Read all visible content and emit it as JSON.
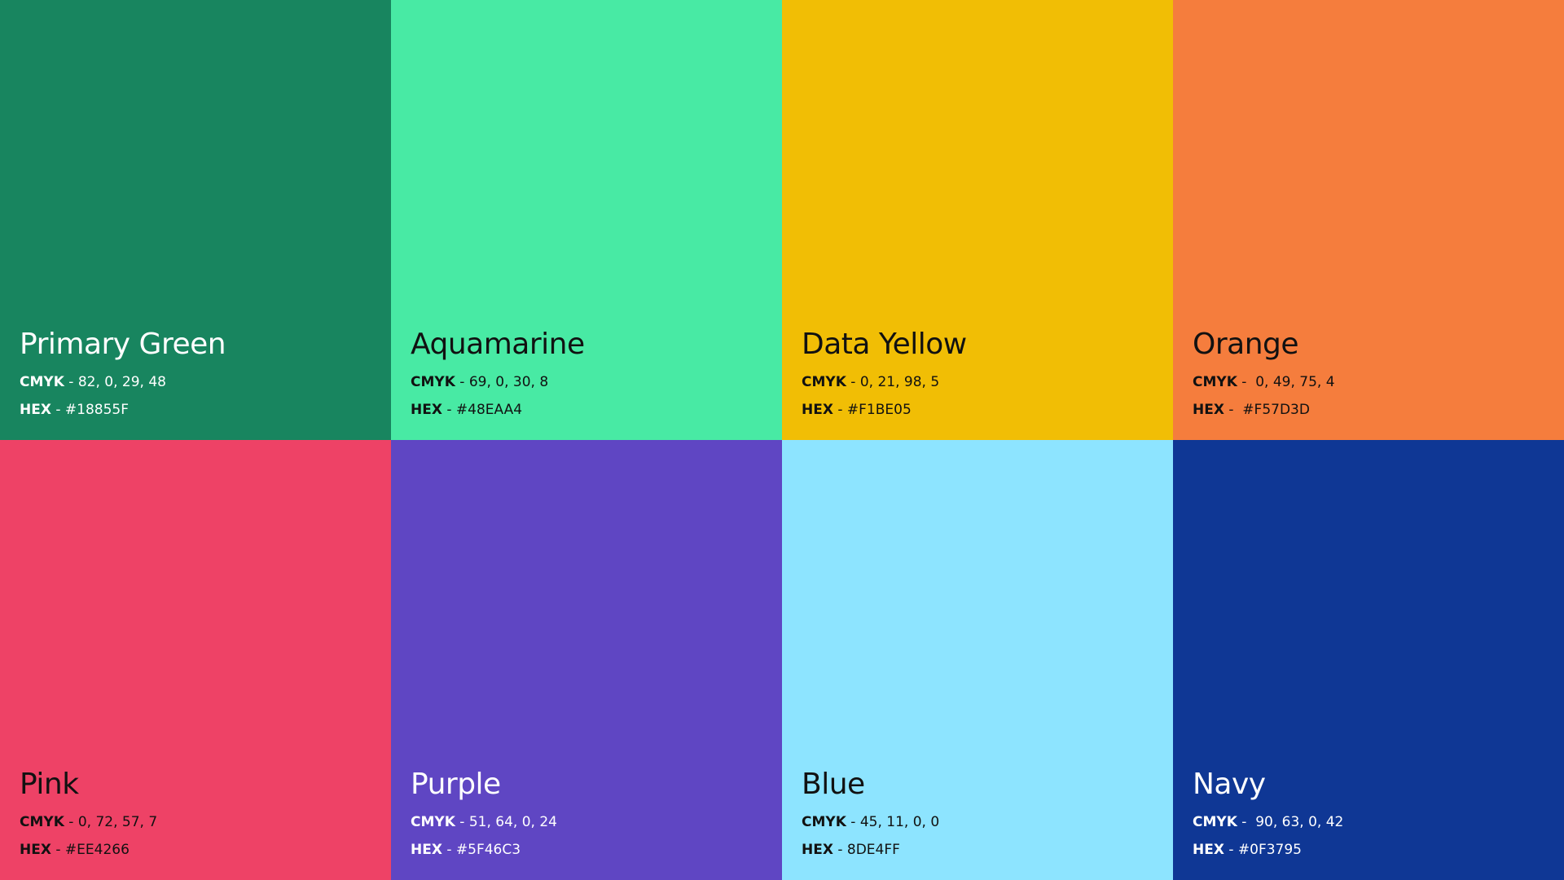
{
  "swatches": [
    {
      "name": "Primary Green",
      "cmyk_label": "CMYK",
      "cmyk_value": " - 82, 0, 29, 48",
      "hex_label": "HEX",
      "hex_value": " - #18855F",
      "color": "#18855F",
      "text_color": "#ffffff"
    },
    {
      "name": "Aquamarine",
      "cmyk_label": "CMYK",
      "cmyk_value": " - 69, 0, 30, 8",
      "hex_label": "HEX",
      "hex_value": " - #48EAA4",
      "color": "#48EAA4",
      "text_color": "#111111"
    },
    {
      "name": "Data Yellow",
      "cmyk_label": "CMYK",
      "cmyk_value": " - 0, 21, 98, 5",
      "hex_label": "HEX",
      "hex_value": " - #F1BE05",
      "color": "#F1BE05",
      "text_color": "#111111"
    },
    {
      "name": "Orange",
      "cmyk_label": "CMYK",
      "cmyk_value": " -  0, 49, 75, 4",
      "hex_label": "HEX",
      "hex_value": " -  #F57D3D",
      "color": "#F57D3D",
      "text_color": "#111111"
    },
    {
      "name": "Pink",
      "cmyk_label": "CMYK",
      "cmyk_value": " - 0, 72, 57, 7",
      "hex_label": "HEX",
      "hex_value": " - #EE4266",
      "color": "#EE4266",
      "text_color": "#111111"
    },
    {
      "name": "Purple",
      "cmyk_label": "CMYK",
      "cmyk_value": " - 51, 64, 0, 24",
      "hex_label": "HEX",
      "hex_value": " - #5F46C3",
      "color": "#5F46C3",
      "text_color": "#ffffff"
    },
    {
      "name": "Blue",
      "cmyk_label": "CMYK",
      "cmyk_value": " - 45, 11, 0, 0",
      "hex_label": "HEX",
      "hex_value": " - 8DE4FF",
      "color": "#8DE4FF",
      "text_color": "#111111"
    },
    {
      "name": "Navy",
      "cmyk_label": "CMYK",
      "cmyk_value": " -  90, 63, 0, 42",
      "hex_label": "HEX",
      "hex_value": " - #0F3795",
      "color": "#0F3795",
      "text_color": "#ffffff"
    }
  ]
}
